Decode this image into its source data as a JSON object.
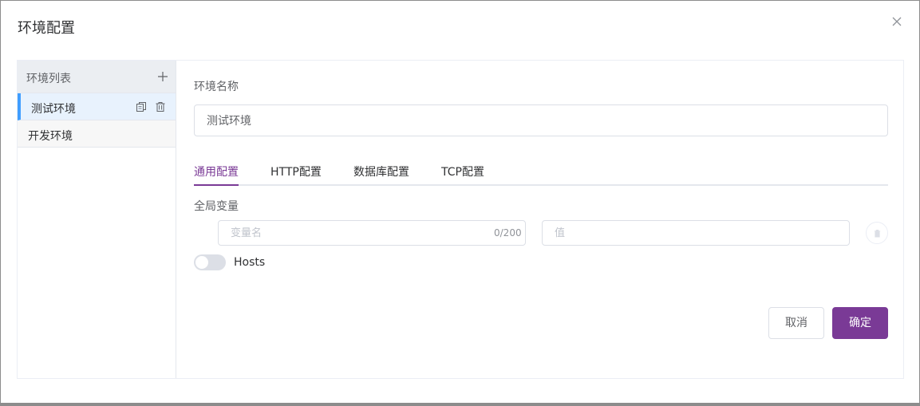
{
  "dialog": {
    "title": "环境配置",
    "close_icon": "close-icon"
  },
  "sidebar": {
    "header_label": "环境列表",
    "add_icon": "plus-icon",
    "items": [
      {
        "label": "测试环境",
        "active": true
      },
      {
        "label": "开发环境",
        "active": false
      }
    ]
  },
  "form": {
    "name_label": "环境名称",
    "name_value": "测试环境",
    "tabs": [
      {
        "label": "通用配置",
        "active": true
      },
      {
        "label": "HTTP配置",
        "active": false
      },
      {
        "label": "数据库配置",
        "active": false
      },
      {
        "label": "TCP配置",
        "active": false
      }
    ],
    "vars_label": "全局变量",
    "var_name_placeholder": "变量名",
    "var_name_count": "0/200",
    "var_value_placeholder": "值",
    "hosts_label": "Hosts",
    "hosts_enabled": false
  },
  "footer": {
    "cancel_label": "取消",
    "confirm_label": "确定"
  },
  "colors": {
    "accent": "#7a3a96",
    "active_item_bg": "#e8f2fd",
    "active_item_border": "#409eff"
  }
}
